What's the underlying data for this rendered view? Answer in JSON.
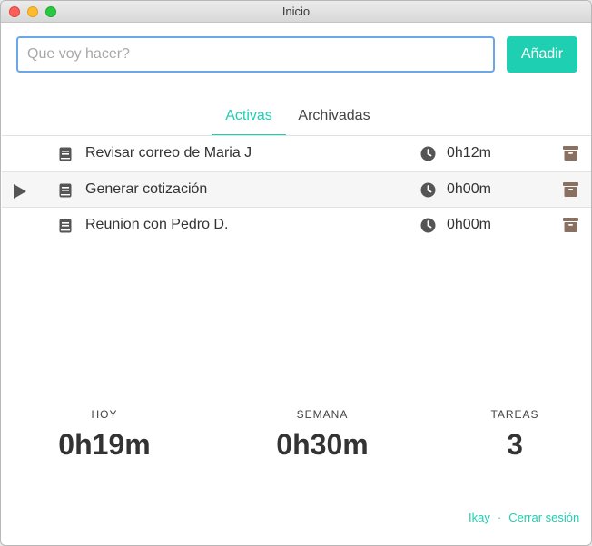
{
  "window": {
    "title": "Inicio"
  },
  "new_task": {
    "placeholder": "Que voy hacer?",
    "value": "",
    "add_label": "Añadir"
  },
  "tabs": [
    {
      "label": "Activas",
      "active": true
    },
    {
      "label": "Archivadas",
      "active": false
    }
  ],
  "tasks": [
    {
      "name": "Revisar correo de Maria J",
      "duration": "0h12m",
      "running": false
    },
    {
      "name": "Generar cotización",
      "duration": "0h00m",
      "running": true
    },
    {
      "name": "Reunion con Pedro D.",
      "duration": "0h00m",
      "running": false
    }
  ],
  "stats": {
    "today": {
      "label": "HOY",
      "value": "0h19m"
    },
    "week": {
      "label": "SEMANA",
      "value": "0h30m"
    },
    "tasks": {
      "label": "TAREAS",
      "value": "3"
    }
  },
  "footer": {
    "user": "Ikay",
    "separator": "·",
    "logout": "Cerrar sesión"
  },
  "icons": {
    "task": "book-icon",
    "time": "clock-icon",
    "archive": "archive-box-icon",
    "play": "play-icon"
  },
  "colors": {
    "accent": "#1fcfb2",
    "focus_border": "#6aa6e8",
    "archive_icon": "#8a7060"
  }
}
